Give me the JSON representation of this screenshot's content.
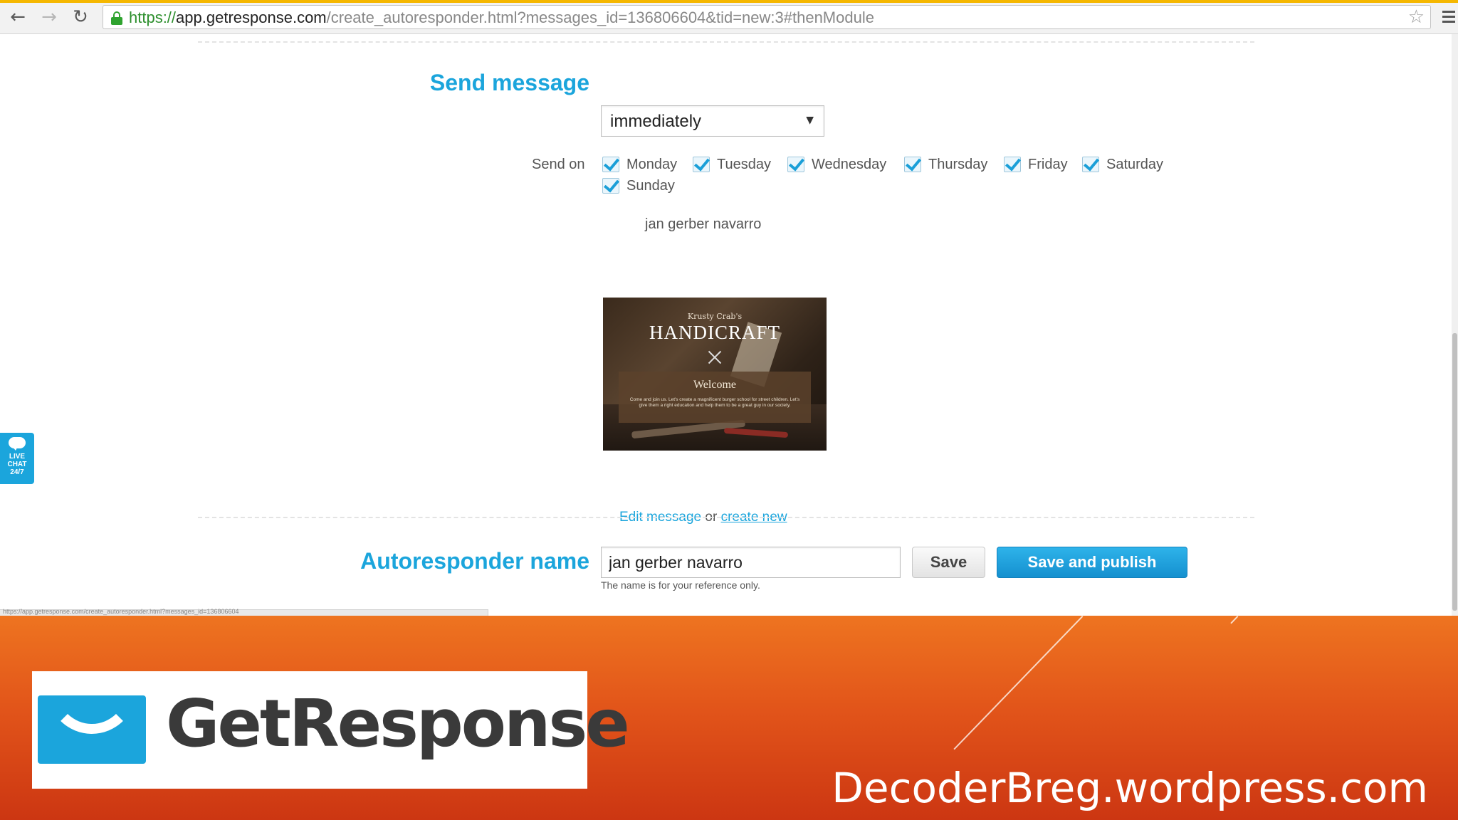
{
  "browser": {
    "url_scheme": "https://",
    "url_host": "app.getresponse.com",
    "url_path": "/create_autoresponder.html?messages_id=136806604&tid=new:3#thenModule",
    "back_icon": "arrow-left-icon",
    "forward_icon": "arrow-right-icon",
    "reload_icon": "reload-icon",
    "lock_icon": "lock-icon",
    "bookmark_icon": "star-icon",
    "menu_icon": "hamburger-menu-icon",
    "status_url": "https://app.getresponse.com/create_autoresponder.html?messages_id=136806604"
  },
  "send_message": {
    "label": "Send message",
    "select_value": "immediately",
    "send_on_label": "Send on",
    "days": [
      {
        "label": "Monday",
        "checked": true
      },
      {
        "label": "Tuesday",
        "checked": true
      },
      {
        "label": "Wednesday",
        "checked": true
      },
      {
        "label": "Thursday",
        "checked": true
      },
      {
        "label": "Friday",
        "checked": true
      },
      {
        "label": "Saturday",
        "checked": true
      },
      {
        "label": "Sunday",
        "checked": true
      }
    ]
  },
  "message": {
    "name": "jan gerber navarro",
    "thumbnail": {
      "pre_title": "Krusty Crab's",
      "title": "HANDICRAFT",
      "welcome": "Welcome",
      "blurb": "Come and join us. Let's create a magnificent burger school for street children. Let's give them a right education and help them to be a great guy in our society."
    },
    "edit_link": "Edit message",
    "or_text": "or",
    "create_link": "create new"
  },
  "autoresponder": {
    "label": "Autoresponder name",
    "name_value": "jan gerber navarro",
    "hint": "The name is for your reference only.",
    "save_label": "Save",
    "publish_label": "Save and publish"
  },
  "livechat": {
    "icon": "chat-bubble-icon",
    "line1": "LIVE",
    "line2": "CHAT",
    "line3": "24/7"
  },
  "banner": {
    "logo_icon": "getresponse-logo-icon",
    "logo_text": "GetResponse",
    "site": "DecoderBreg.wordpress.com"
  },
  "colors": {
    "accent": "#1ba5dc",
    "banner_orange": "#e2551a",
    "ssl_green": "#2fa32f"
  }
}
